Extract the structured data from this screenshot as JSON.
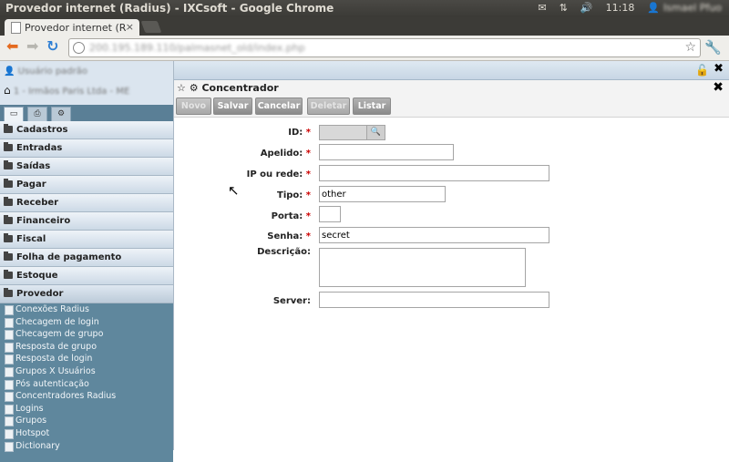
{
  "os": {
    "window_title": "Provedor internet (Radius) - IXCsoft - Google Chrome",
    "time": "11:18",
    "user": "Ismael Pfuo"
  },
  "browser": {
    "tab_title": "Provedor internet (Radius",
    "tab_close": "×",
    "url": "200.195.189.110/palmasnet_old/index.php"
  },
  "sidebar": {
    "user_label": "Usuário padrão",
    "company_label": "1 - Irmãos Paris Ltda - ME",
    "menu": [
      {
        "label": "Cadastros"
      },
      {
        "label": "Entradas"
      },
      {
        "label": "Saídas"
      },
      {
        "label": "Pagar"
      },
      {
        "label": "Receber"
      },
      {
        "label": "Financeiro"
      },
      {
        "label": "Fiscal"
      },
      {
        "label": "Folha de pagamento"
      },
      {
        "label": "Estoque"
      },
      {
        "label": "Provedor"
      }
    ],
    "submenu": [
      {
        "label": "Conexões Radius"
      },
      {
        "label": "Checagem de login"
      },
      {
        "label": "Checagem de grupo"
      },
      {
        "label": "Resposta de grupo"
      },
      {
        "label": "Resposta de login"
      },
      {
        "label": "Grupos X Usuários"
      },
      {
        "label": "Pós autenticação"
      },
      {
        "label": "Concentradores Radius"
      },
      {
        "label": "Logins"
      },
      {
        "label": "Grupos"
      },
      {
        "label": "Hotspot"
      },
      {
        "label": "Dictionary"
      }
    ]
  },
  "form": {
    "title": "Concentrador",
    "buttons": {
      "novo": "Novo",
      "salvar": "Salvar",
      "cancelar": "Cancelar",
      "deletar": "Deletar",
      "listar": "Listar"
    },
    "fields": {
      "id": {
        "label": "ID:",
        "value": ""
      },
      "apelido": {
        "label": "Apelido:",
        "value": ""
      },
      "ip": {
        "label": "IP ou rede:",
        "value": ""
      },
      "tipo": {
        "label": "Tipo:",
        "value": "other"
      },
      "porta": {
        "label": "Porta:",
        "value": ""
      },
      "senha": {
        "label": "Senha:",
        "value": "secret"
      },
      "descricao": {
        "label": "Descrição:",
        "value": ""
      },
      "server": {
        "label": "Server:",
        "value": ""
      }
    },
    "required_mark": "*"
  }
}
